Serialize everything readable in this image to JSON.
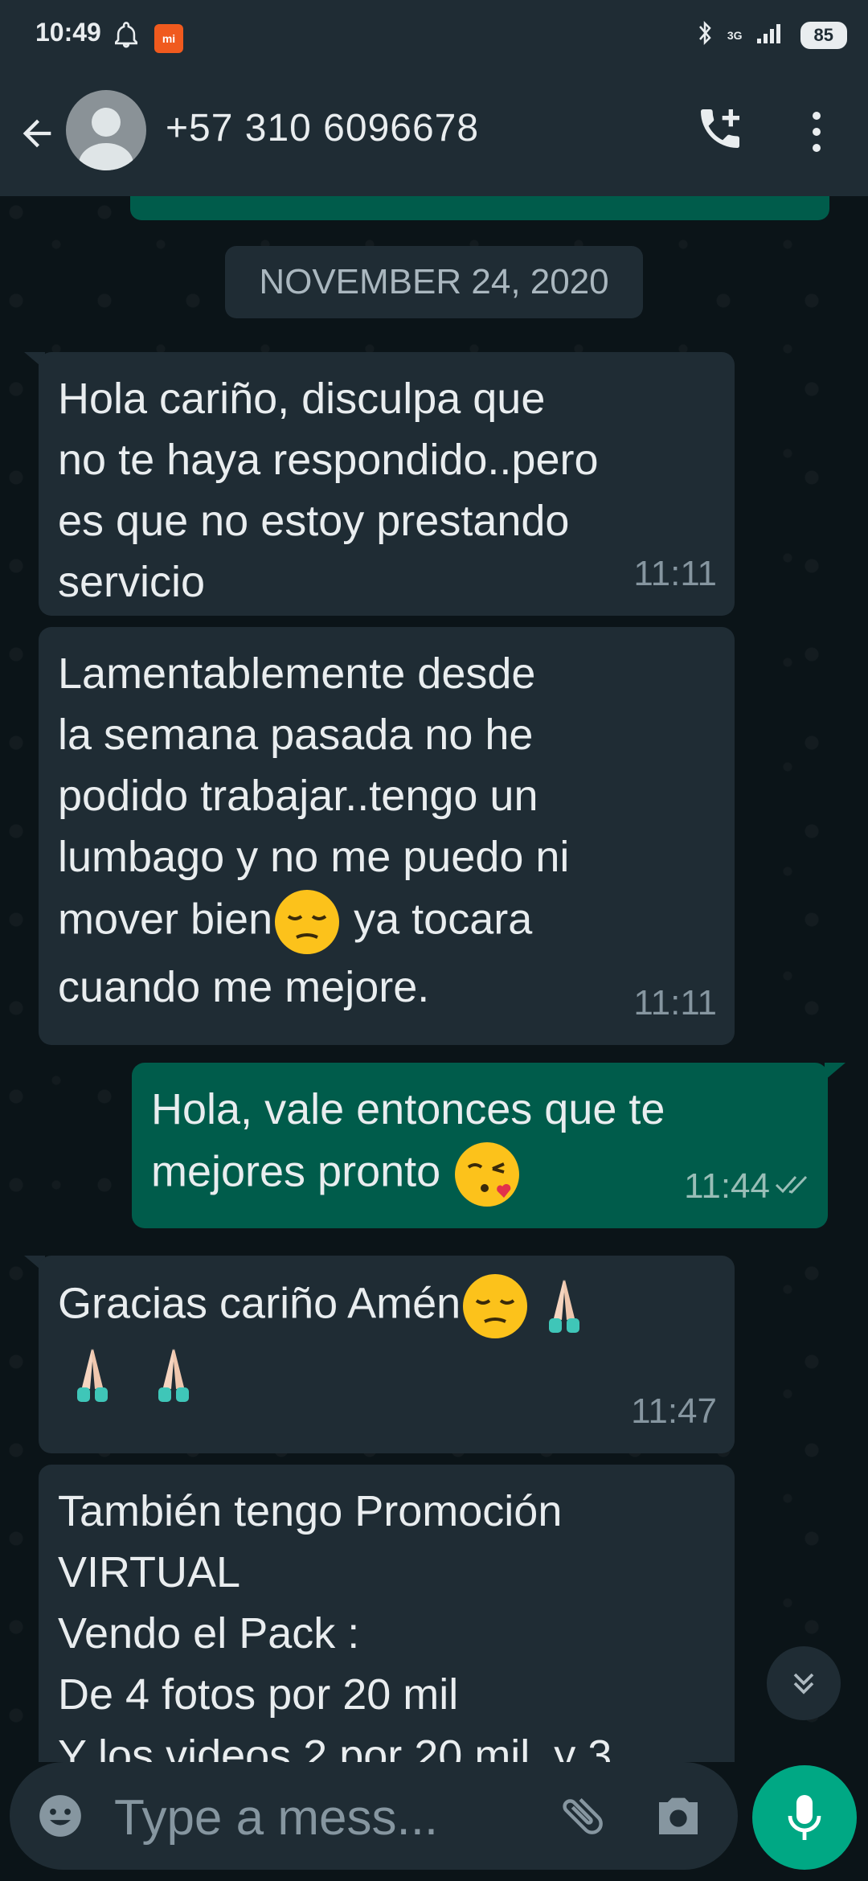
{
  "status_bar": {
    "time": "10:49",
    "network": "3G",
    "battery": "85"
  },
  "header": {
    "contact": "+57 310 6096678"
  },
  "chat": {
    "date_label": "NOVEMBER 24, 2020",
    "messages": [
      {
        "dir": "in",
        "text": "Hola cariño, disculpa que\nno te haya respondido..pero\nes que no estoy prestando\nservicio",
        "time": "11:11"
      },
      {
        "dir": "in",
        "text_a": "Lamentablemente desde\nla semana pasada no he\npodido trabajar..tengo un\nlumbago y no me puedo ni\nmover bien",
        "text_b": " ya tocara\ncuando me mejore.",
        "time": "11:11"
      },
      {
        "dir": "out",
        "text": "Hola, vale entonces que te\nmejores pronto ",
        "time": "11:44",
        "status": "read"
      },
      {
        "dir": "in",
        "text": "Gracias cariño Amén",
        "time": "11:47"
      },
      {
        "dir": "in",
        "text": "También tengo Promoción\nVIRTUAL\nVendo el Pack :\n De 4 fotos por 20 mil\nY los videos 2 por 20 mil, y 3"
      }
    ]
  },
  "composer": {
    "placeholder": "Type a mess..."
  },
  "icons": [
    "back-icon",
    "avatar",
    "add-call-icon",
    "more-icon",
    "emoji-icon",
    "attach-icon",
    "camera-icon",
    "mic-icon",
    "scroll-down-icon"
  ],
  "colors": {
    "app_bar": "#1f2c34",
    "incoming": "#1f2c34",
    "outgoing": "#005c4b",
    "accent": "#00a884",
    "background": "#0b1418"
  }
}
